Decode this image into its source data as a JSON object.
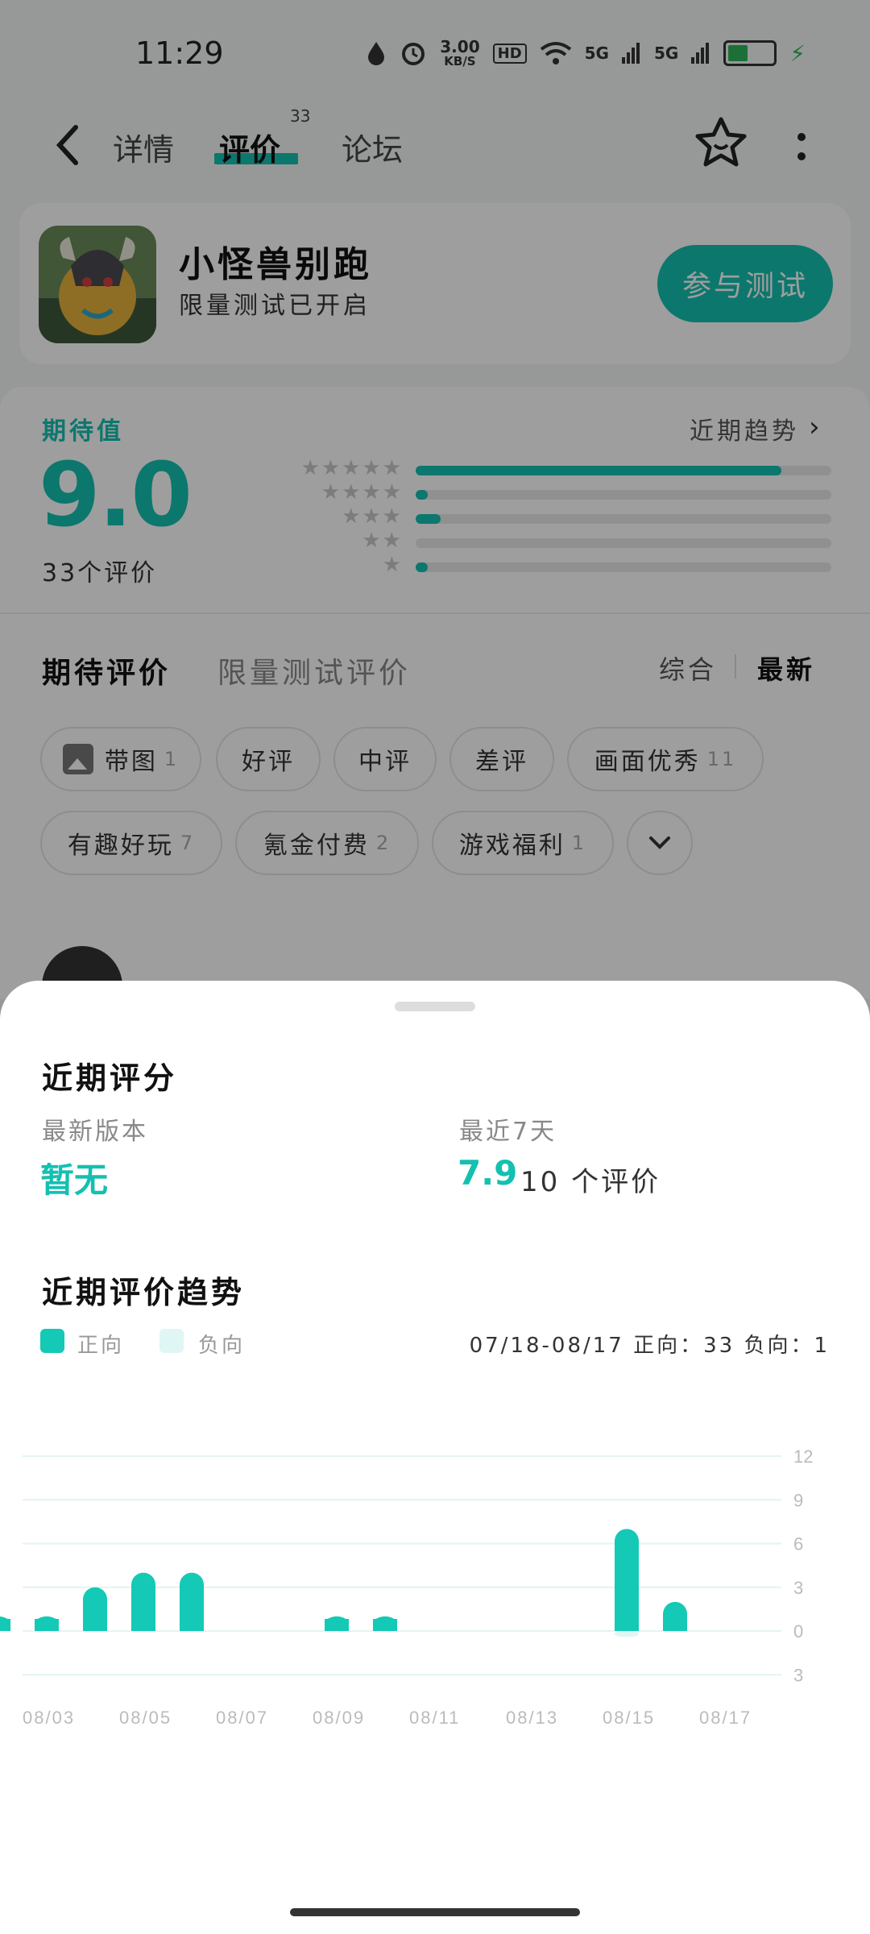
{
  "status_bar": {
    "time": "11:29",
    "net_speed_value": "3.00",
    "net_speed_unit": "KB/S",
    "hd_label": "HD",
    "signal1": "5G",
    "signal2": "5G",
    "battery_level": 0.45,
    "icons": [
      "water-drop-icon",
      "alarm-icon",
      "wifi-icon",
      "signal-icon",
      "battery-icon",
      "charging-icon"
    ]
  },
  "nav": {
    "tabs": [
      {
        "label": "详情"
      },
      {
        "label": "评价",
        "count": "33"
      },
      {
        "label": "论坛"
      }
    ],
    "active_tab": 1
  },
  "app": {
    "name": "小怪兽别跑",
    "subtitle": "限量测试已开启",
    "join_label": "参与测试"
  },
  "rating": {
    "label": "期待值",
    "score": "9.0",
    "count_text": "33个评价",
    "trend_link": "近期趋势",
    "distribution": [
      {
        "stars": 5,
        "fraction": 0.88
      },
      {
        "stars": 4,
        "fraction": 0.03
      },
      {
        "stars": 3,
        "fraction": 0.06
      },
      {
        "stars": 2,
        "fraction": 0.0
      },
      {
        "stars": 1,
        "fraction": 0.03
      }
    ]
  },
  "reviews": {
    "tabs": [
      "期待评价",
      "限量测试评价"
    ],
    "sort_options": [
      "综合",
      "最新"
    ],
    "sort_active": 1,
    "chips": [
      {
        "label": "带图",
        "count": "1"
      },
      {
        "label": "好评",
        "count": ""
      },
      {
        "label": "中评",
        "count": ""
      },
      {
        "label": "差评",
        "count": ""
      },
      {
        "label": "画面优秀",
        "count": "11"
      },
      {
        "label": "有趣好玩",
        "count": "7"
      },
      {
        "label": "氪金付费",
        "count": "2"
      },
      {
        "label": "游戏福利",
        "count": "1"
      }
    ]
  },
  "sheet": {
    "title": "近期评分",
    "latest_version_label": "最新版本",
    "latest_version_value": "暂无",
    "last7_label": "最近7天",
    "last7_score": "7.9",
    "last7_count": "10 个评价",
    "trend_title": "近期评价趋势",
    "legend_positive": "正向",
    "legend_negative": "负向",
    "range_text": "07/18-08/17   正向：33   负向：1",
    "colors": {
      "positive": "#14c9b6",
      "negative": "#dff6f4",
      "accent": "#14c0b0"
    }
  },
  "chart_data": {
    "type": "bar",
    "ylim": [
      -3,
      12
    ],
    "y_ticks": [
      "12",
      "9",
      "6",
      "3",
      "0",
      "3"
    ],
    "x_ticks": [
      "08/03",
      "08/05",
      "08/07",
      "08/09",
      "08/11",
      "08/13",
      "08/15",
      "08/17"
    ],
    "categories": [
      "08/02",
      "08/03",
      "08/04",
      "08/05",
      "08/06",
      "08/07",
      "08/08",
      "08/09",
      "08/10",
      "08/11",
      "08/12",
      "08/13",
      "08/14",
      "08/15",
      "08/16",
      "08/17"
    ],
    "series": [
      {
        "name": "正向",
        "values": [
          1,
          1,
          3,
          4,
          4,
          0,
          0,
          1,
          1,
          0,
          0,
          0,
          0,
          7,
          2,
          0
        ]
      },
      {
        "name": "负向",
        "values": [
          0,
          0,
          0,
          0,
          0,
          0,
          0,
          0,
          0,
          0,
          0,
          0,
          0,
          1,
          0,
          0
        ]
      }
    ]
  }
}
